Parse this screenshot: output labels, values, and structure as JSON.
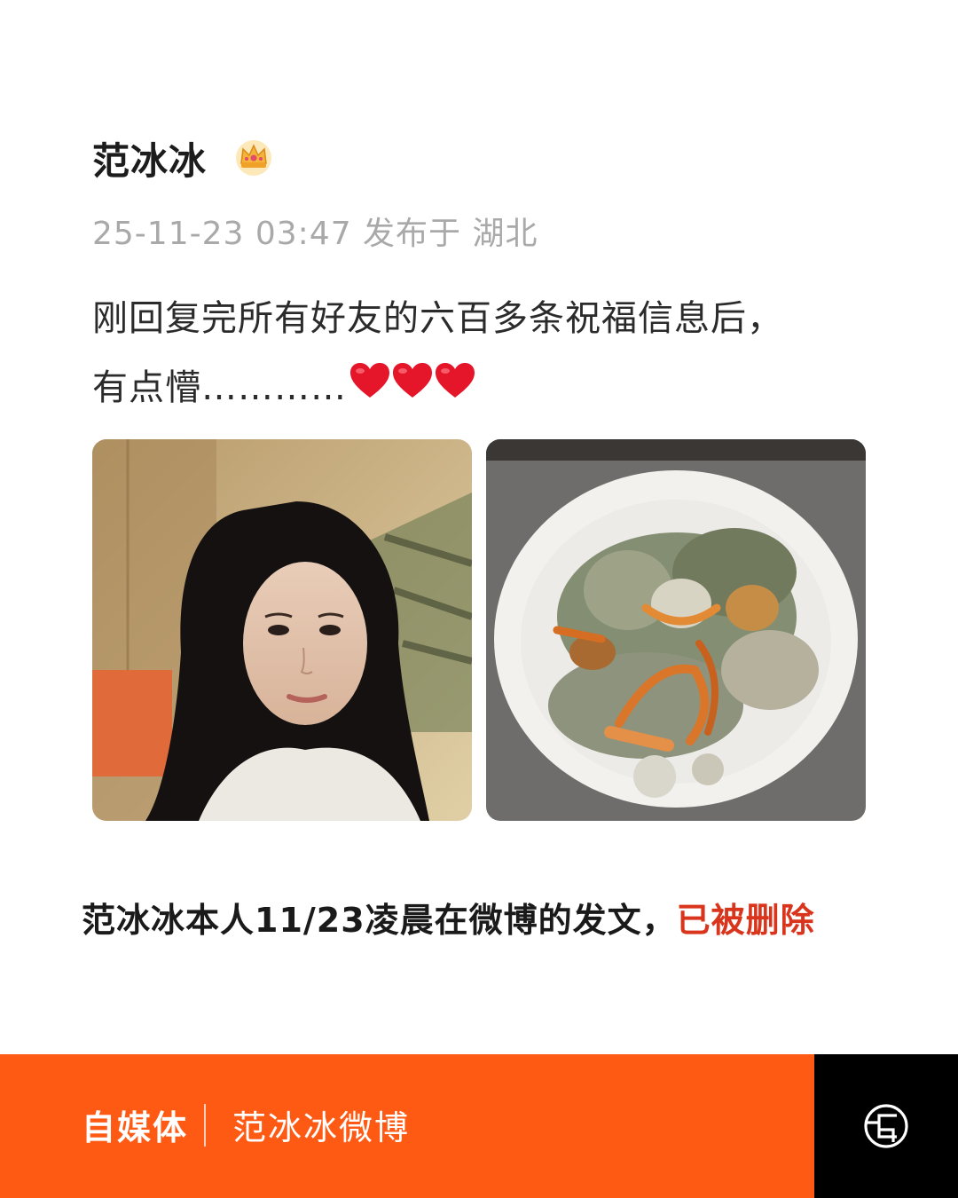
{
  "post": {
    "user_name": "范冰冰",
    "meta": "25-11-23 03:47 发布于 湖北",
    "text_line1": "刚回复完所有好友的六百多条祝福信息后，",
    "text_line2": "有点懵…………",
    "images": [
      "selfie",
      "dish"
    ]
  },
  "caption": {
    "main": "范冰冰本人11/23凌晨在微博的发文，",
    "highlight": "已被删除",
    "highlight_color": "#d9341c"
  },
  "footer": {
    "source": "自媒体",
    "topic": "范冰冰微博",
    "bar_color": "#ff5a14",
    "logo_icon": "brand-logo-icon"
  }
}
